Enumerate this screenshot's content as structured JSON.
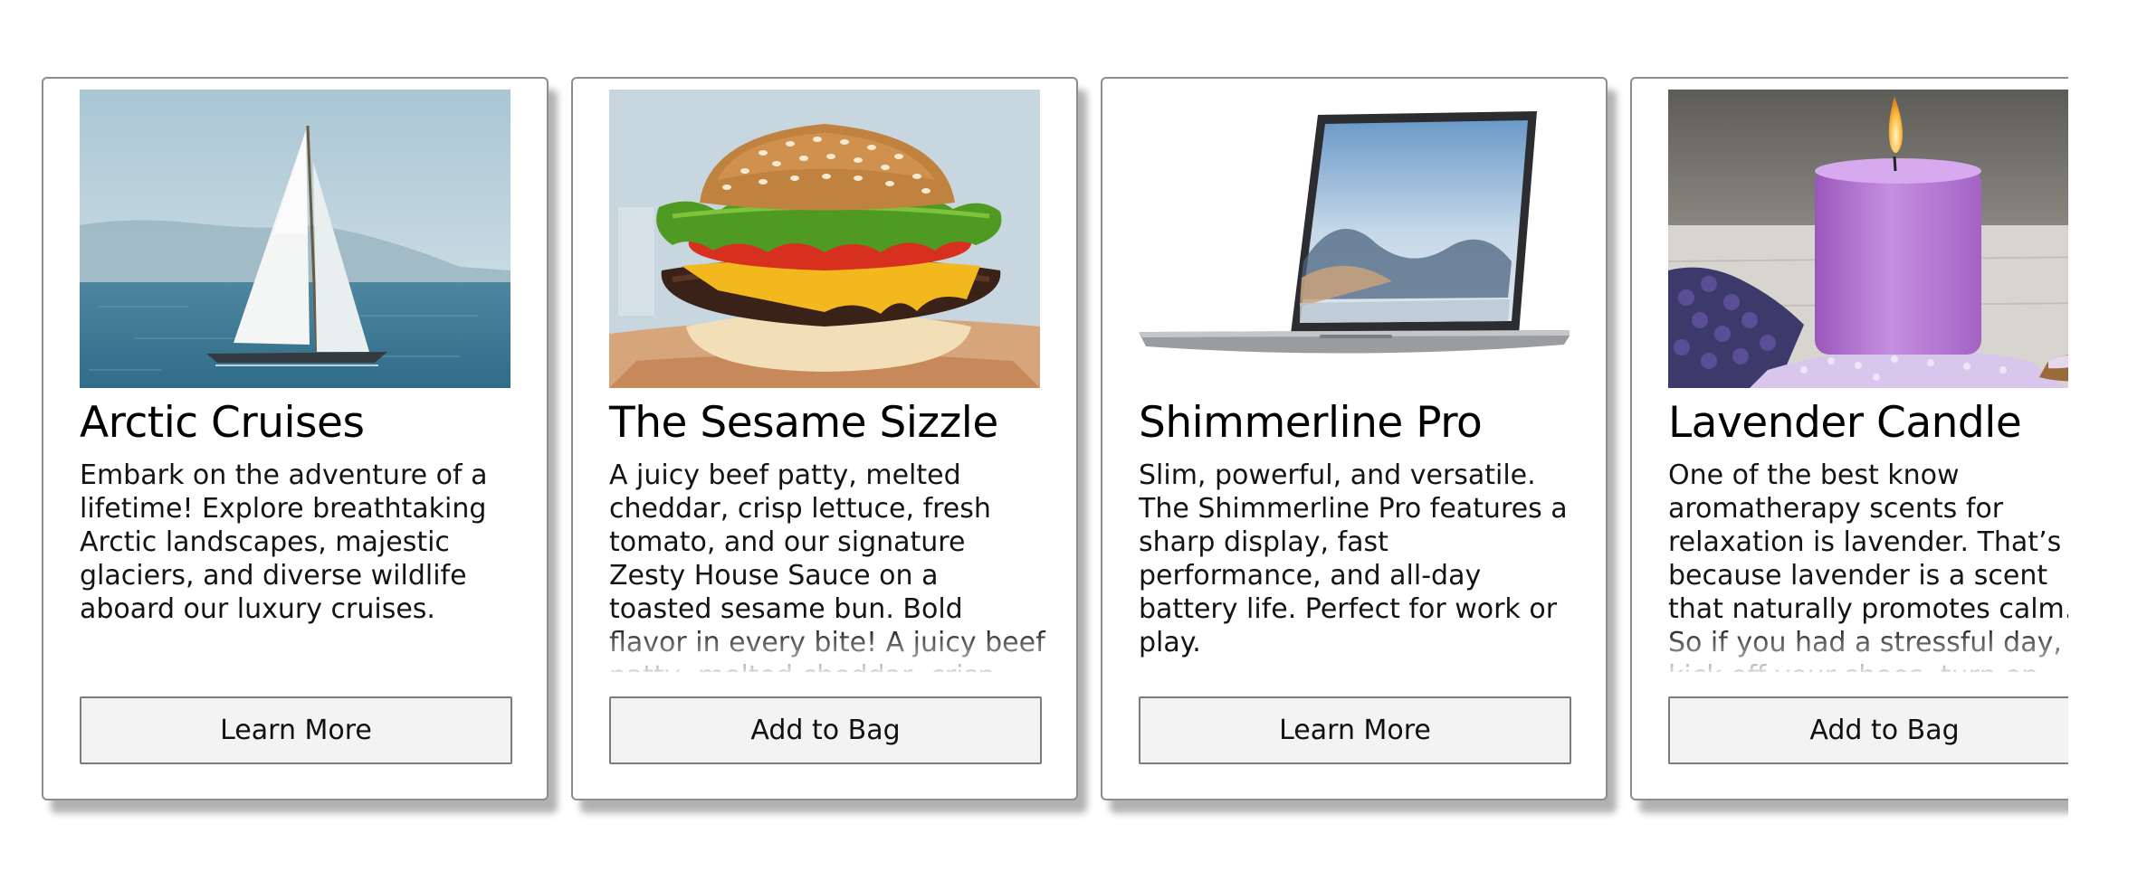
{
  "cards": [
    {
      "image": "sailboat-on-sea",
      "title": "Arctic Cruises",
      "description": "Embark on the adventure of a lifetime! Explore breathtaking Arctic landscapes, majestic glaciers, and diverse wildlife aboard our luxury cruises.",
      "button_label": "Learn More"
    },
    {
      "image": "cheeseburger",
      "title": "The Sesame Sizzle",
      "description": "A juicy beef patty, melted cheddar, crisp lettuce, fresh tomato, and our signature Zesty House Sauce on a toasted sesame bun. Bold flavor in every bite! A juicy beef patty, melted cheddar, crisp lettuce, fresh",
      "button_label": "Add to Bag"
    },
    {
      "image": "laptop",
      "title": "Shimmerline Pro",
      "description": "Slim, powerful, and versatile. The Shimmerline Pro features a sharp display, fast performance, and all-day battery life. Perfect for work or play.",
      "button_label": "Learn More"
    },
    {
      "image": "lavender-candle",
      "title": "Lavender Candle",
      "description": "One of the best know aromatherapy scents for relaxation is lavender. That’s because lavender is a scent that naturally promotes calm. So if you had a stressful day, kick off your shoes, turn on some",
      "button_label": "Add to Bag"
    }
  ]
}
